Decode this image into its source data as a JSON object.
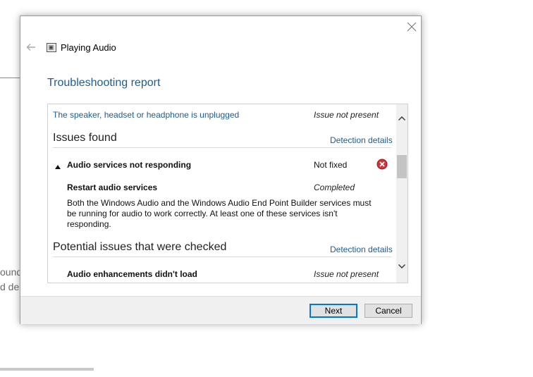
{
  "background": {
    "text_fragment_1": "ound",
    "text_fragment_2": "d de"
  },
  "dialog": {
    "app_title": "Playing Audio",
    "page_title": "Troubleshooting report",
    "icons": {
      "close": "close-icon",
      "back": "back-arrow-icon",
      "app": "troubleshooter-app-icon",
      "error": "error-x-icon",
      "collapse": "collapse-triangle-icon"
    }
  },
  "report": {
    "top_item": {
      "label": "The speaker, headset or headphone is unplugged",
      "status": "Issue not present"
    },
    "issues_found": {
      "heading": "Issues found",
      "details_link": "Detection details",
      "issue": {
        "title": "Audio services not responding",
        "status": "Not fixed",
        "fix_title": "Restart audio services",
        "fix_status": "Completed",
        "description": "Both the Windows Audio and the Windows Audio End Point Builder services must be running for audio to work correctly. At least one of these services isn't responding."
      }
    },
    "potential_issues": {
      "heading": "Potential issues that were checked",
      "details_link": "Detection details",
      "items": [
        {
          "title": "Audio enhancements didn't load",
          "status": "Issue not present"
        }
      ]
    }
  },
  "footer": {
    "next_label": "Next",
    "cancel_label": "Cancel"
  },
  "colors": {
    "link_blue": "#1c5c94",
    "error_red": "#d13438",
    "focus_blue": "#0078d7"
  }
}
